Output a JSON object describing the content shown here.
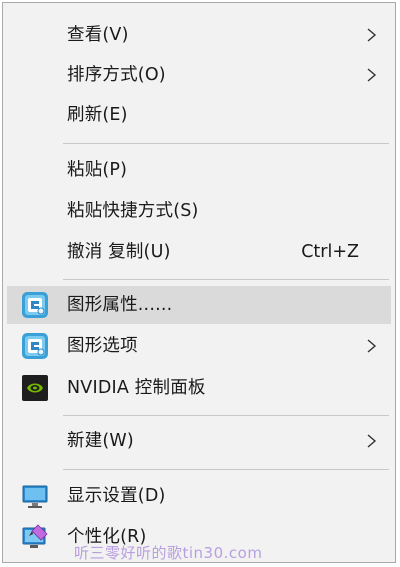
{
  "menu": {
    "items": {
      "view": {
        "label": "查看(V)",
        "icon": "chevron-right-icon"
      },
      "sort": {
        "label": "排序方式(O)",
        "icon": "chevron-right-icon"
      },
      "refresh": {
        "label": "刷新(E)"
      },
      "paste": {
        "label": "粘贴(P)"
      },
      "paste_shortcut": {
        "label": "粘贴快捷方式(S)"
      },
      "undo_copy": {
        "label": "撤消 复制(U)",
        "shortcut": "Ctrl+Z"
      },
      "graphics_properties": {
        "label": "图形属性......",
        "icon": "intel-graphics-icon"
      },
      "graphics_options": {
        "label": "图形选项",
        "icon": "intel-graphics-icon"
      },
      "nvidia_panel": {
        "label": "NVIDIA 控制面板",
        "icon": "nvidia-icon"
      },
      "new": {
        "label": "新建(W)",
        "icon": "chevron-right-icon"
      },
      "display_settings": {
        "label": "显示设置(D)",
        "icon": "monitor-icon"
      },
      "personalize": {
        "label": "个性化(R)",
        "icon": "personalize-icon"
      }
    },
    "hover_item": "graphics_properties"
  },
  "watermark": {
    "text": "听三零好听的歌tin30.com"
  },
  "colors": {
    "menu_bg": "#f2f2f2",
    "hover_bg": "#dadada",
    "separator": "#c8c8c8",
    "border": "#a9a9a9",
    "intel_blue": "#3aa0d8",
    "nvidia_green": "#76b900",
    "watermark": "#b89fe0"
  }
}
